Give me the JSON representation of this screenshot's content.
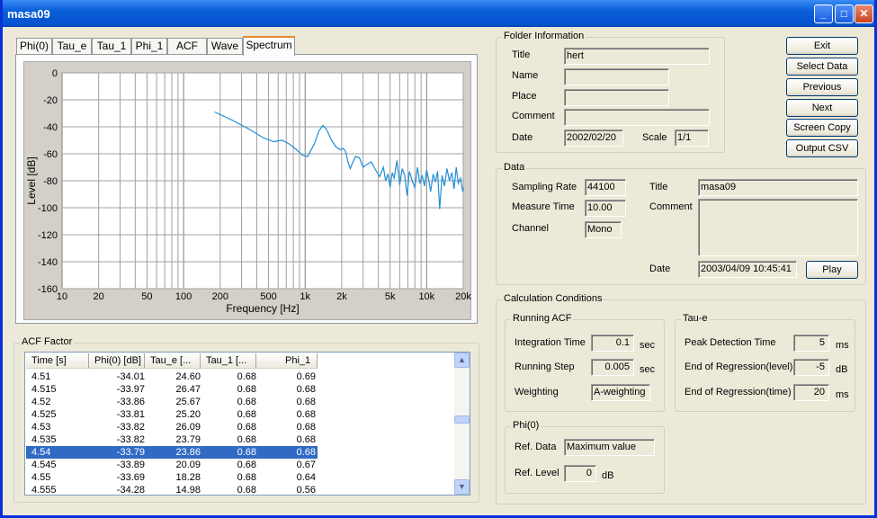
{
  "window": {
    "title": "masa09"
  },
  "tabs": [
    "Phi(0)",
    "Tau_e",
    "Tau_1",
    "Phi_1",
    "ACF",
    "Wave",
    "Spectrum"
  ],
  "active_tab": "Spectrum",
  "chart_data": {
    "type": "line",
    "xlabel": "Frequency [Hz]",
    "ylabel": "Level [dB]",
    "xscale": "log",
    "xlim": [
      10,
      20000
    ],
    "ylim": [
      -160,
      0
    ],
    "xticks": [
      "10",
      "20",
      "50",
      "100",
      "200",
      "500",
      "1k",
      "2k",
      "5k",
      "10k",
      "20k"
    ],
    "xtick_values": [
      10,
      20,
      50,
      100,
      200,
      500,
      1000,
      2000,
      5000,
      10000,
      20000
    ],
    "yticks": [
      0,
      -20,
      -40,
      -60,
      -80,
      -100,
      -120,
      -140,
      -160
    ],
    "grid": true,
    "color": "#1f8fd6",
    "x": [
      180,
      250,
      350,
      450,
      550,
      650,
      750,
      850,
      950,
      1050,
      1200,
      1300,
      1400,
      1500,
      1650,
      1800,
      1950,
      2050,
      2150,
      2250,
      2350,
      2450,
      2600,
      2800,
      3000,
      3200,
      3500,
      3800,
      4100,
      4400,
      4600,
      4800,
      5000,
      5200,
      5400,
      5700,
      6000,
      6300,
      6600,
      6900,
      7200,
      7600,
      8000,
      8400,
      8800,
      9200,
      9600,
      10000,
      10400,
      10800,
      11300,
      11800,
      12300,
      12800,
      13400,
      14000,
      14700,
      15400,
      16100,
      16800,
      17500,
      18200,
      19000,
      19800,
      20000
    ],
    "y": [
      -29,
      -35,
      -42,
      -48,
      -51,
      -50,
      -53,
      -57,
      -61,
      -62,
      -52,
      -43,
      -39,
      -42,
      -50,
      -55,
      -57,
      -56,
      -58,
      -66,
      -71,
      -67,
      -62,
      -63,
      -70,
      -68,
      -66,
      -72,
      -77,
      -70,
      -80,
      -75,
      -85,
      -74,
      -78,
      -65,
      -83,
      -71,
      -76,
      -91,
      -73,
      -80,
      -85,
      -70,
      -82,
      -76,
      -84,
      -72,
      -79,
      -88,
      -75,
      -81,
      -73,
      -101,
      -76,
      -84,
      -71,
      -80,
      -74,
      -86,
      -70,
      -82,
      -78,
      -88,
      -85
    ]
  },
  "acf_factor": {
    "title": "ACF Factor",
    "columns": [
      "Time [s]",
      "Phi(0) [dB]",
      "Tau_e [...",
      "Tau_1 [...",
      "Phi_1"
    ],
    "rows": [
      [
        "4.51",
        "-34.01",
        "24.60",
        "0.68",
        "0.69"
      ],
      [
        "4.515",
        "-33.97",
        "26.47",
        "0.68",
        "0.68"
      ],
      [
        "4.52",
        "-33.86",
        "25.67",
        "0.68",
        "0.68"
      ],
      [
        "4.525",
        "-33.81",
        "25.20",
        "0.68",
        "0.68"
      ],
      [
        "4.53",
        "-33.82",
        "26.09",
        "0.68",
        "0.68"
      ],
      [
        "4.535",
        "-33.82",
        "23.79",
        "0.68",
        "0.68"
      ],
      [
        "4.54",
        "-33.79",
        "23.86",
        "0.68",
        "0.68"
      ],
      [
        "4.545",
        "-33.89",
        "20.09",
        "0.68",
        "0.67"
      ],
      [
        "4.55",
        "-33.69",
        "18.28",
        "0.68",
        "0.64"
      ],
      [
        "4.555",
        "-34.28",
        "14.98",
        "0.68",
        "0.56"
      ]
    ],
    "selected_index": 6
  },
  "folder": {
    "title": "Folder Information",
    "title_label": "Title",
    "title_value": "hert",
    "name_label": "Name",
    "name_value": "",
    "place_label": "Place",
    "place_value": "",
    "comment_label": "Comment",
    "comment_value": "",
    "date_label": "Date",
    "date_value": "2002/02/20",
    "scale_label": "Scale",
    "scale_value": "1/1"
  },
  "buttons": {
    "exit": "Exit",
    "select_data": "Select Data",
    "previous": "Previous",
    "next": "Next",
    "screen_copy": "Screen Copy",
    "output_csv": "Output CSV",
    "play": "Play"
  },
  "data": {
    "title": "Data",
    "sampling_rate_label": "Sampling Rate",
    "sampling_rate": "44100",
    "measure_time_label": "Measure Time",
    "measure_time": "10.00",
    "channel_label": "Channel",
    "channel": "Mono",
    "title_label": "Title",
    "title_value": "masa09",
    "comment_label": "Comment",
    "comment_value": "",
    "date_label": "Date",
    "date_value": "2003/04/09 10:45:41"
  },
  "calc": {
    "title": "Calculation Conditions",
    "running_acf": {
      "title": "Running ACF",
      "integration_label": "Integration Time",
      "integration": "0.1",
      "integration_unit": "sec",
      "step_label": "Running Step",
      "step": "0.005",
      "step_unit": "sec",
      "weighting_label": "Weighting",
      "weighting": "A-weighting"
    },
    "tau_e": {
      "title": "Tau-e",
      "peak_label": "Peak Detection Time",
      "peak": "5",
      "peak_unit": "ms",
      "level_label": "End of Regression(level)",
      "level": "-5",
      "level_unit": "dB",
      "time_label": "End of Regression(time)",
      "time": "20",
      "time_unit": "ms"
    },
    "phi0": {
      "title": "Phi(0)",
      "ref_data_label": "Ref. Data",
      "ref_data": "Maximum value",
      "ref_level_label": "Ref. Level",
      "ref_level": "0",
      "ref_level_unit": "dB"
    }
  }
}
